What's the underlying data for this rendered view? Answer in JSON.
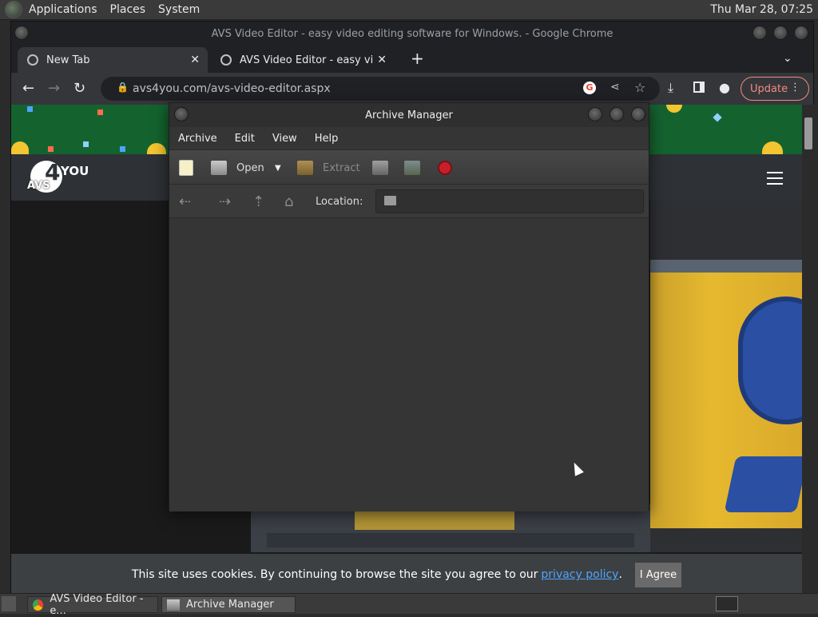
{
  "top_panel": {
    "menus": [
      "Applications",
      "Places",
      "System"
    ],
    "clock": "Thu Mar 28, 07:25"
  },
  "chrome": {
    "window_title": "AVS Video Editor - easy video editing software for Windows. - Google Chrome",
    "tabs": [
      {
        "label": "New Tab",
        "active": true
      },
      {
        "label": "AVS Video Editor - easy video",
        "active": false
      }
    ],
    "url": "avs4you.com/avs-video-editor.aspx",
    "update_label": "Update"
  },
  "page": {
    "logo_text": "AVS 4YOU",
    "cookie_text": "This site uses cookies. By continuing to browse the site you agree to our",
    "cookie_link": "privacy policy",
    "cookie_period": ".",
    "agree_label": "I Agree"
  },
  "archive_manager": {
    "title": "Archive Manager",
    "menu": [
      "Archive",
      "Edit",
      "View",
      "Help"
    ],
    "toolbar": {
      "open_label": "Open",
      "extract_label": "Extract"
    },
    "location_label": "Location:"
  },
  "taskbar": {
    "tasks": [
      "AVS Video Editor - e...",
      "Archive Manager"
    ]
  },
  "colors": {
    "banner": "#14632f",
    "update_accent": "#f28b82",
    "link": "#4ea4ff"
  }
}
